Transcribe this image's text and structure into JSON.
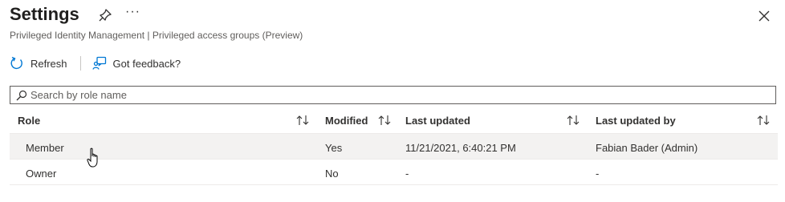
{
  "header": {
    "title": "Settings",
    "more": "···",
    "subtitle": "Privileged Identity Management | Privileged access groups (Preview)"
  },
  "toolbar": {
    "refresh_label": "Refresh",
    "feedback_label": "Got feedback?"
  },
  "search": {
    "placeholder": "Search by role name"
  },
  "table": {
    "columns": [
      "Role",
      "Modified",
      "Last updated",
      "Last updated by"
    ],
    "rows": [
      {
        "role": "Member",
        "modified": "Yes",
        "last_updated": "11/21/2021, 6:40:21 PM",
        "last_updated_by": "Fabian Bader (Admin)"
      },
      {
        "role": "Owner",
        "modified": "No",
        "last_updated": "-",
        "last_updated_by": "-"
      }
    ]
  },
  "colors": {
    "accent": "#0078d4",
    "selected_row": "#f3f2f1",
    "border": "#edebe9"
  },
  "icons": [
    "pin-icon",
    "more-icon",
    "close-icon",
    "refresh-icon",
    "feedback-icon",
    "search-icon",
    "sort-icon",
    "hand-cursor-icon"
  ]
}
